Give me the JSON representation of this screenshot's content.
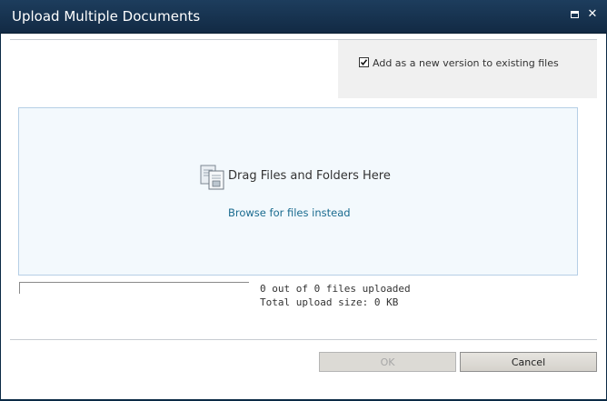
{
  "dialog": {
    "title": "Upload Multiple Documents",
    "maximize_icon": "maximize-icon",
    "close_glyph": "✕"
  },
  "options": {
    "add_as_new_version": {
      "label": "Add as a new version to existing files",
      "checked": true
    }
  },
  "dropzone": {
    "icon": "documents-icon",
    "drag_text": "Drag Files and Folders Here",
    "browse_link": "Browse for files instead"
  },
  "progress": {
    "fraction": 0,
    "files_status": "0 out of 0 files uploaded",
    "total_size": "Total upload size: 0 KB"
  },
  "buttons": {
    "ok": {
      "label": "OK",
      "enabled": false
    },
    "cancel": {
      "label": "Cancel",
      "enabled": true
    }
  },
  "colors": {
    "titlebar": "#142f4a",
    "dropzone_bg": "#f3f9fd",
    "dropzone_border": "#b6cfe6",
    "link": "#1a6b8f"
  }
}
